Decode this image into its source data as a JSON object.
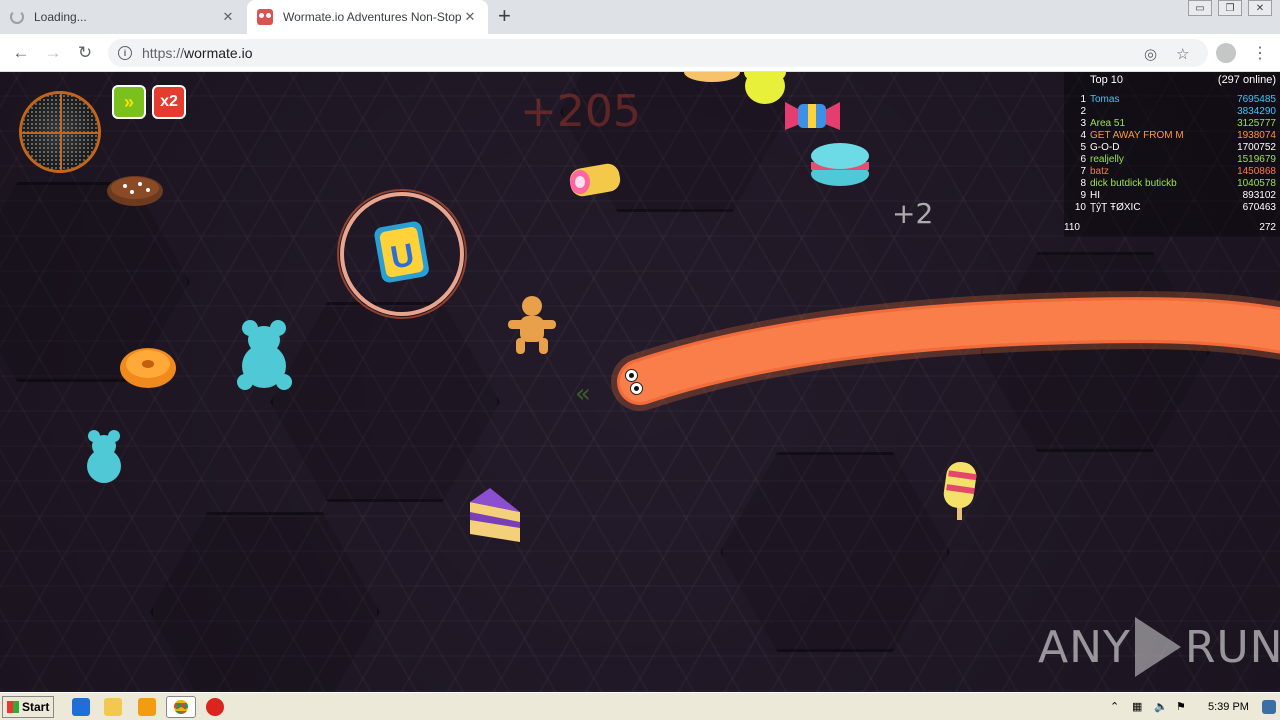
{
  "browser": {
    "tabs": [
      {
        "label": "Loading...",
        "state": "loading"
      },
      {
        "label": "Wormate.io Adventures Non-Stop",
        "state": "active"
      }
    ],
    "new_tab": "+",
    "url_scheme": "https://",
    "url_host": "wormate.io",
    "window_controls": {
      "minimize": "▭",
      "restore": "❐",
      "close": "✕"
    }
  },
  "game": {
    "powerups": {
      "boost": "»",
      "multiplier": "x2"
    },
    "score_popup_big": "+205",
    "score_popup_small": "+2",
    "leaderboard": {
      "title": "Top 10",
      "online": "(297 online)",
      "rows": [
        {
          "rank": "1",
          "name": "Tomas",
          "score": "7695485",
          "color": "#3ec4ff"
        },
        {
          "rank": "2",
          "name": "",
          "score": "3834290",
          "color": "#3ec4ff"
        },
        {
          "rank": "3",
          "name": "Area 51",
          "score": "3125777",
          "color": "#9be34a"
        },
        {
          "rank": "4",
          "name": "GET AWAY FROM M",
          "score": "1938074",
          "color": "#ff9933"
        },
        {
          "rank": "5",
          "name": "G-O-D",
          "score": "1700752",
          "color": "#ffffff"
        },
        {
          "rank": "6",
          "name": "realjelly",
          "score": "1519679",
          "color": "#9be34a"
        },
        {
          "rank": "7",
          "name": "batz",
          "score": "1450868",
          "color": "#ff7744"
        },
        {
          "rank": "8",
          "name": "dick butdick butickb",
          "score": "1040578",
          "color": "#9be34a"
        },
        {
          "rank": "9",
          "name": "HI",
          "score": "893102",
          "color": "#ffffff"
        },
        {
          "rank": "10",
          "name": "ŢŷŢ ŦØXİĆ",
          "score": "670463",
          "color": "#ffffff"
        }
      ],
      "my_rank": "110",
      "my_score": "272"
    },
    "watermark": {
      "left": "ANY",
      "right": "RUN"
    },
    "worm_color": "#f26b3a"
  },
  "taskbar": {
    "start": "Start",
    "clock": "5:39 PM"
  }
}
